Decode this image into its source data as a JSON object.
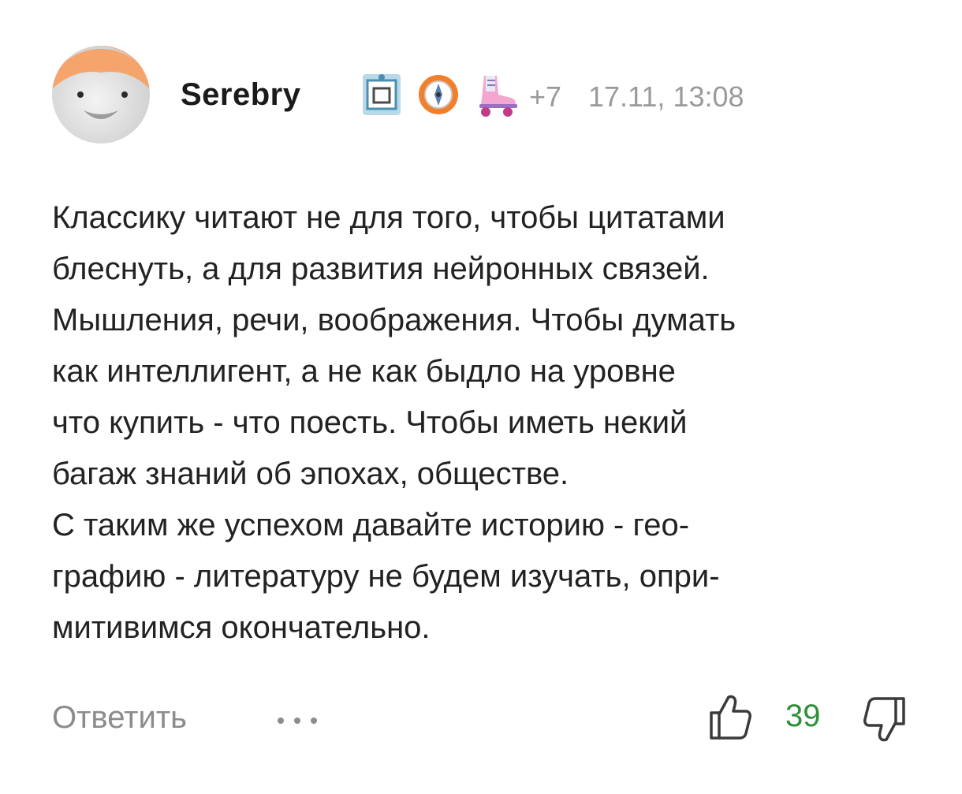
{
  "comment": {
    "author": "Serebry",
    "badges": [
      {
        "icon": "picture-frame-icon"
      },
      {
        "icon": "compass-icon"
      },
      {
        "icon": "roller-skate-icon"
      }
    ],
    "extra_badges": "+7",
    "timestamp": "17.11, 13:08",
    "text_lines": [
      "Классику читают не для того, чтобы цитатами",
      "блеснуть, а для развития нейронных связей.",
      "Мышления, речи, воображения. Чтобы думать",
      "как интеллигент, а не как быдло на уровне",
      "что купить - что поесть. Чтобы иметь некий",
      "багаж знаний об эпохах, обществе.",
      "С таким же успехом давайте историю - гео-",
      "графию - литературу не будем изучать, опри-",
      "митивимся окончательно."
    ]
  },
  "footer": {
    "reply_label": "Ответить",
    "more_icon": "more-dots-icon",
    "like_icon": "thumbs-up-icon",
    "like_count": "39",
    "dislike_icon": "thumbs-down-icon"
  },
  "colors": {
    "text": "#222222",
    "muted": "#8c8c8c",
    "like_count": "#2f8f3a",
    "avatar_hair": "#f08a4b",
    "avatar_face": "#e6e6e6"
  }
}
